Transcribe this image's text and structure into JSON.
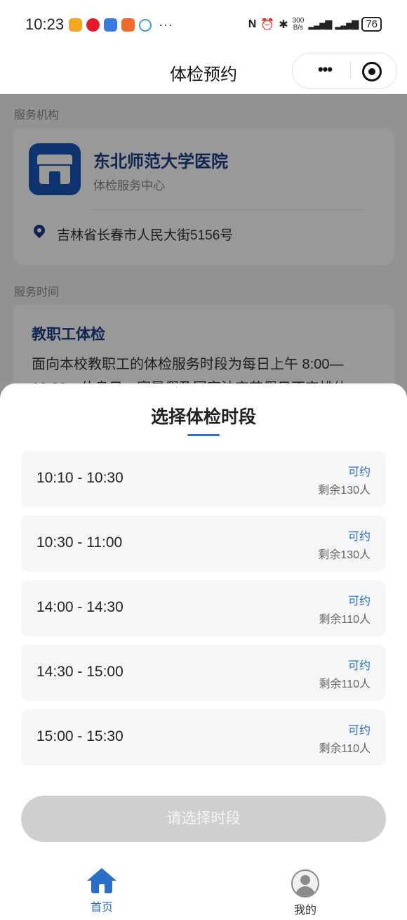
{
  "status_bar": {
    "time": "10:23",
    "net_speed": "300",
    "net_unit": "B/s",
    "battery": "76"
  },
  "nav": {
    "title": "体检预约"
  },
  "page": {
    "institution_label": "服务机构",
    "institution_name": "东北师范大学医院",
    "institution_subtitle": "体检服务中心",
    "address": "吉林省长春市人民大街5156号",
    "service_time_label": "服务时间",
    "service_title": "教职工体检",
    "service_desc": "面向本校教职工的体检服务时段为每日上午 8:00—10:00，休息日、寒暑假及国家法定节假日不安排体"
  },
  "sheet": {
    "title": "选择体检时段",
    "slots": [
      {
        "time": "10:10 - 10:30",
        "status": "可约",
        "remaining": "剩余130人"
      },
      {
        "time": "10:30 - 11:00",
        "status": "可约",
        "remaining": "剩余130人"
      },
      {
        "time": "14:00 - 14:30",
        "status": "可约",
        "remaining": "剩余110人"
      },
      {
        "time": "14:30 - 15:00",
        "status": "可约",
        "remaining": "剩余110人"
      },
      {
        "time": "15:00 - 15:30",
        "status": "可约",
        "remaining": "剩余110人"
      }
    ],
    "confirm_label": "请选择时段"
  },
  "tabs": {
    "home": "首页",
    "me": "我的"
  },
  "colors": {
    "accent": "#2b6fc9",
    "institution_blue": "#1d3f87",
    "disabled_button": "#cfcfcf"
  }
}
